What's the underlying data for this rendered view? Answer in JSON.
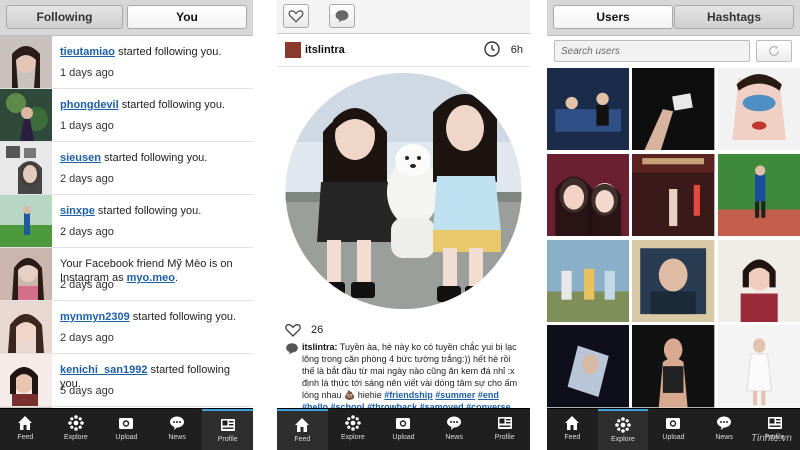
{
  "screens": {
    "activity": {
      "segment": [
        "Following",
        "You"
      ],
      "active_segment": "You",
      "items": [
        {
          "user": "tieutamiao",
          "text": " started following you.",
          "time": "1 days ago"
        },
        {
          "user": "phongdevil",
          "text": " started following you.",
          "time": "1 days ago"
        },
        {
          "user": "sieusen",
          "text": " started following you.",
          "time": "2 days ago"
        },
        {
          "user": "sinxpe",
          "text": " started following you.",
          "time": "2 days ago"
        },
        {
          "prefix": "Your Facebook friend Mỹ Mèo is on Instagram as ",
          "user": "myo.meo",
          "text": ".",
          "time": "2 days ago"
        },
        {
          "user": "mynmyn2309",
          "text": " started following you.",
          "time": "2 days ago"
        },
        {
          "user": "kenichi_san1992",
          "text": " started following you.",
          "time": "5 days ago"
        }
      ]
    },
    "post": {
      "username": "itslintra",
      "time_ago": "6h",
      "likes": "26",
      "caption_user": "itslintra:",
      "caption_text": " Tuyền àa, hè này ko có tuyền chắc yui bị lạc lõng trong căn phòng 4 bức tường trắng:)) hết hè rồi thế là bắt đầu từ mai ngày nào cũng ăn kem đá nhỉ :x định là thức tới sáng nên viết vài dòng tâm sự cho ấm lòng nhau 💩 hiehie ",
      "hashtags": [
        "#friendship",
        "#summer",
        "#end",
        "#hello",
        "#school",
        "#throwback",
        "#samoyed",
        "#converse"
      ]
    },
    "explore": {
      "segment": [
        "Users",
        "Hashtags"
      ],
      "active_segment": "Users",
      "search_placeholder": "Search users",
      "grid_count": 12,
      "watermark": "Tinhte.vn"
    }
  },
  "tabbar": [
    {
      "label": "Feed",
      "icon": "home-icon"
    },
    {
      "label": "Explore",
      "icon": "explore-star-icon"
    },
    {
      "label": "Upload",
      "icon": "camera-icon"
    },
    {
      "label": "News",
      "icon": "speech-bubble-icon"
    },
    {
      "label": "Profile",
      "icon": "profile-card-icon"
    }
  ],
  "selected_tabs": {
    "activity": "Profile",
    "post": "Feed",
    "explore": "Explore"
  },
  "colors": {
    "link": "#1c5fa7",
    "tabbar": "#1f1f1f",
    "tab_selected_accent": "#3aa0d8"
  }
}
